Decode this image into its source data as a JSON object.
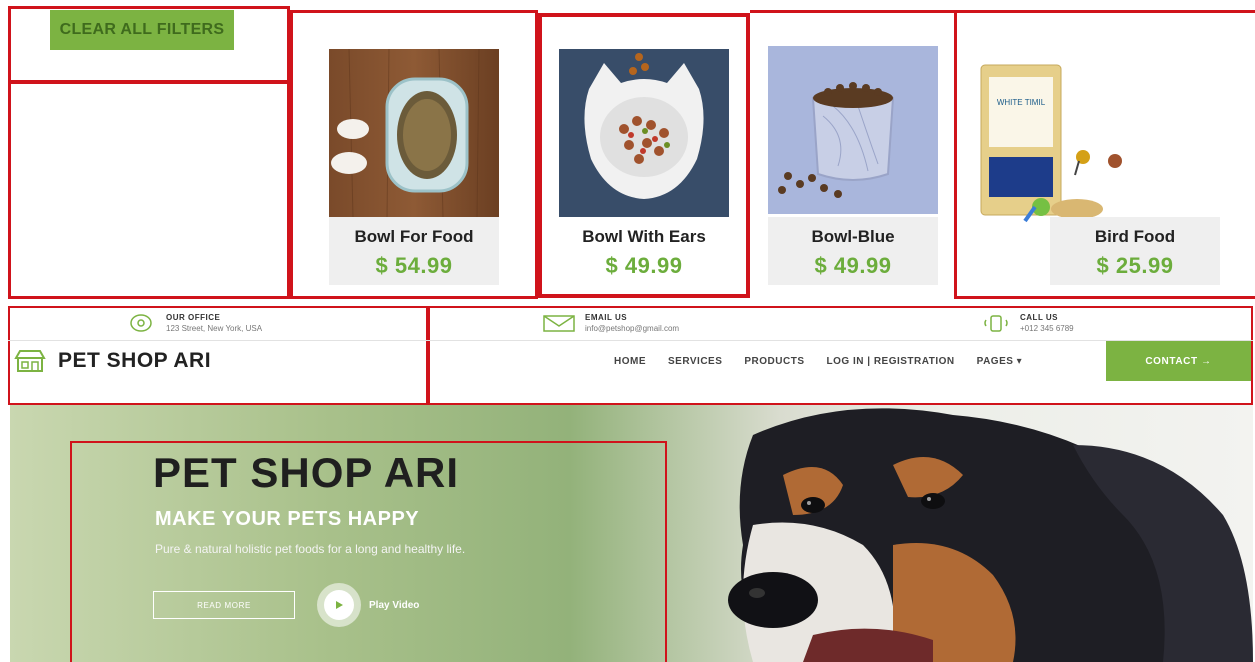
{
  "filters": {
    "clear_label": "CLEAR ALL FILTERS"
  },
  "products": [
    {
      "name": "Bowl For Food",
      "price": "$ 54.99",
      "image": "food-bowl-with-paws"
    },
    {
      "name": "Bowl With Ears",
      "price": "$ 49.99",
      "image": "cat-ear-bowl-with-kibble"
    },
    {
      "name": "Bowl-Blue",
      "price": "$ 49.99",
      "image": "blue-marble-bowl"
    },
    {
      "name": "Bird Food",
      "price": "$ 25.99",
      "image": "bird-seed-bag-with-birds",
      "package_text": "WHITE TIMIL"
    }
  ],
  "header": {
    "office": {
      "label": "OUR OFFICE",
      "value": "123 Street, New York, USA",
      "icon": "map-pin-icon"
    },
    "email": {
      "label": "EMAIL US",
      "value": "info@petshop@gmail.com",
      "icon": "envelope-icon"
    },
    "call": {
      "label": "CALL US",
      "value": "+012 345 6789",
      "icon": "phone-icon"
    },
    "brand": "PET SHOP ARI",
    "nav": [
      "HOME",
      "SERVICES",
      "PRODUCTS",
      "LOG IN | REGISTRATION",
      "PAGES ▾"
    ],
    "contact_label": "CONTACT →"
  },
  "hero": {
    "title": "PET SHOP ARI",
    "subtitle": "MAKE YOUR PETS HAPPY",
    "tagline": "Pure & natural holistic pet foods for a long and healthy life.",
    "read_more": "READ MORE",
    "play_video": "Play Video"
  },
  "colors": {
    "accent_green": "#7cb342",
    "price_green": "#6cad3c",
    "annotation_red": "#d0131b"
  }
}
